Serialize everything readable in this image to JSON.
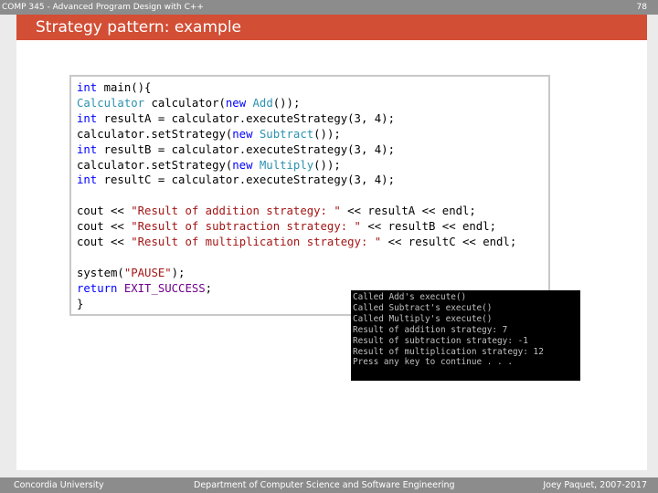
{
  "header": {
    "course": "COMP 345 - Advanced Program Design with C++",
    "page_number": "78"
  },
  "slide": {
    "title": "Strategy pattern: example"
  },
  "code": {
    "lines": [
      [
        {
          "t": "int",
          "c": "kw"
        },
        {
          "t": " main(){"
        }
      ],
      [
        {
          "t": "Calculator",
          "c": "cls"
        },
        {
          "t": " calculator("
        },
        {
          "t": "new",
          "c": "kw"
        },
        {
          "t": " "
        },
        {
          "t": "Add",
          "c": "cls"
        },
        {
          "t": "());"
        }
      ],
      [
        {
          "t": "int",
          "c": "kw"
        },
        {
          "t": " resultA = calculator.executeStrategy(3, 4);"
        }
      ],
      [
        {
          "t": "calculator.setStrategy("
        },
        {
          "t": "new",
          "c": "kw"
        },
        {
          "t": " "
        },
        {
          "t": "Subtract",
          "c": "cls"
        },
        {
          "t": "());"
        }
      ],
      [
        {
          "t": "int",
          "c": "kw"
        },
        {
          "t": " resultB = calculator.executeStrategy(3, 4);"
        }
      ],
      [
        {
          "t": "calculator.setStrategy("
        },
        {
          "t": "new",
          "c": "kw"
        },
        {
          "t": " "
        },
        {
          "t": "Multiply",
          "c": "cls"
        },
        {
          "t": "());"
        }
      ],
      [
        {
          "t": "int",
          "c": "kw"
        },
        {
          "t": " resultC = calculator.executeStrategy(3, 4);"
        }
      ],
      [],
      [
        {
          "t": "cout << "
        },
        {
          "t": "\"Result of addition strategy: \"",
          "c": "str"
        },
        {
          "t": " << resultA << endl;"
        }
      ],
      [
        {
          "t": "cout << "
        },
        {
          "t": "\"Result of subtraction strategy: \"",
          "c": "str"
        },
        {
          "t": " << resultB << endl;"
        }
      ],
      [
        {
          "t": "cout << "
        },
        {
          "t": "\"Result of multiplication strategy: \"",
          "c": "str"
        },
        {
          "t": " << resultC << endl;"
        }
      ],
      [],
      [
        {
          "t": "system("
        },
        {
          "t": "\"PAUSE\"",
          "c": "str"
        },
        {
          "t": ");"
        }
      ],
      [
        {
          "t": "return",
          "c": "kw"
        },
        {
          "t": " "
        },
        {
          "t": "EXIT_SUCCESS",
          "c": "mac"
        },
        {
          "t": ";"
        }
      ],
      [
        {
          "t": "}"
        }
      ]
    ]
  },
  "console": {
    "lines": [
      "Called Add's execute()",
      "Called Subtract's execute()",
      "Called Multiply's execute()",
      "Result of addition strategy: 7",
      "Result of subtraction strategy: -1",
      "Result of multiplication strategy: 12",
      "Press any key to continue . . ."
    ]
  },
  "footer": {
    "left": "Concordia University",
    "center": "Department of Computer Science and Software Engineering",
    "right": "Joey Paquet, 2007-2017"
  },
  "colors": {
    "title_bar": "#d24e35",
    "gray_bar": "#8c8c8c"
  }
}
